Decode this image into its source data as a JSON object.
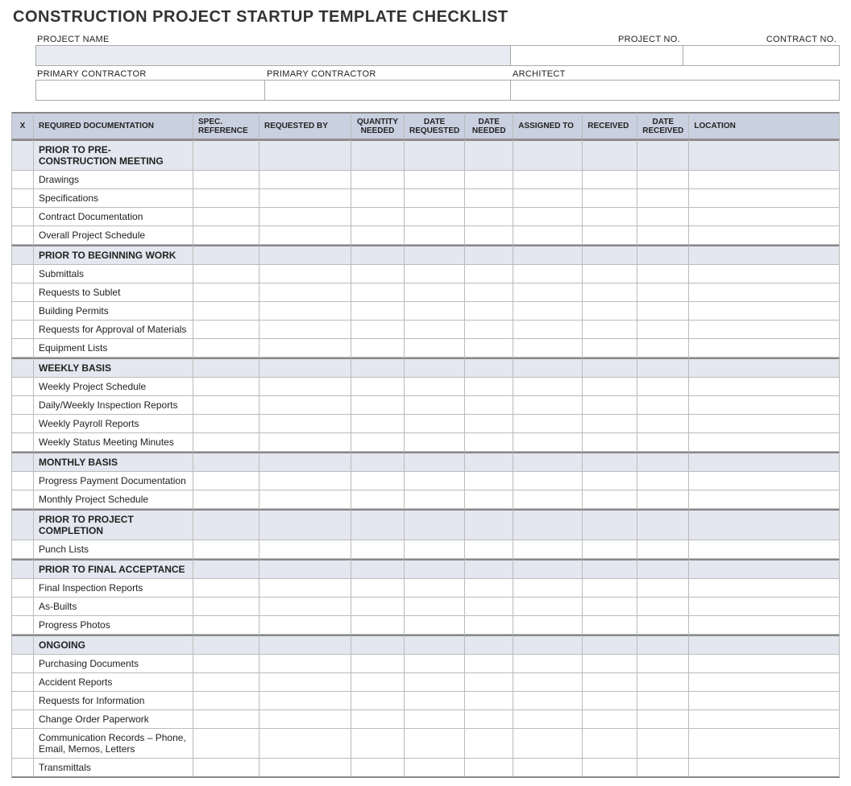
{
  "title": "CONSTRUCTION PROJECT STARTUP TEMPLATE CHECKLIST",
  "meta": {
    "top": [
      {
        "label": "PROJECT NAME",
        "value": ""
      },
      {
        "label": "PROJECT NO.",
        "value": ""
      },
      {
        "label": "CONTRACT NO.",
        "value": ""
      }
    ],
    "bot": [
      {
        "label": "PRIMARY CONTRACTOR",
        "value": ""
      },
      {
        "label": "PRIMARY CONTRACTOR",
        "value": ""
      },
      {
        "label": "ARCHITECT",
        "value": ""
      }
    ]
  },
  "columns": {
    "x": "X",
    "doc": "REQUIRED DOCUMENTATION",
    "spec": "SPEC. REFERENCE",
    "req": "REQUESTED BY",
    "qty": "QUANTITY NEEDED",
    "dreq": "DATE REQUESTED",
    "dneed": "DATE NEEDED",
    "asg": "ASSIGNED TO",
    "rcv": "RECEIVED",
    "drcv": "DATE RECEIVED",
    "loc": "LOCATION"
  },
  "sections": [
    {
      "title": "PRIOR TO PRE-CONSTRUCTION MEETING",
      "items": [
        "Drawings",
        "Specifications",
        "Contract Documentation",
        "Overall Project Schedule"
      ]
    },
    {
      "title": "PRIOR TO BEGINNING WORK",
      "items": [
        "Submittals",
        "Requests to Sublet",
        "Building Permits",
        "Requests for Approval of Materials",
        "Equipment Lists"
      ]
    },
    {
      "title": "WEEKLY BASIS",
      "items": [
        "Weekly Project Schedule",
        "Daily/Weekly Inspection Reports",
        "Weekly Payroll Reports",
        "Weekly Status Meeting Minutes"
      ]
    },
    {
      "title": "MONTHLY BASIS",
      "items": [
        "Progress Payment Documentation",
        "Monthly Project Schedule"
      ]
    },
    {
      "title": "PRIOR TO PROJECT COMPLETION",
      "items": [
        "Punch Lists"
      ]
    },
    {
      "title": "PRIOR TO FINAL ACCEPTANCE",
      "items": [
        "Final Inspection Reports",
        "As-Builts",
        "Progress Photos"
      ]
    },
    {
      "title": "ONGOING",
      "items": [
        "Purchasing Documents",
        "Accident Reports",
        "Requests for Information",
        "Change Order Paperwork",
        "Communication Records – Phone, Email, Memos, Letters",
        "Transmittals"
      ]
    }
  ]
}
